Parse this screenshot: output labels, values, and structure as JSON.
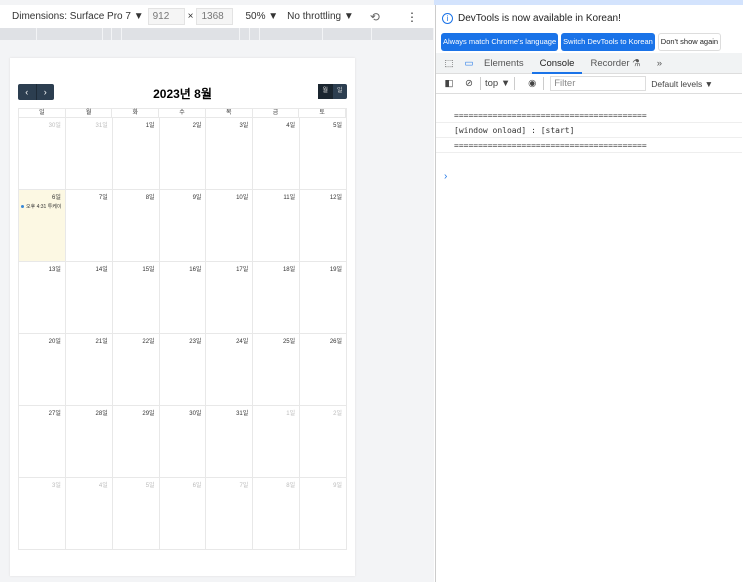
{
  "device_toolbar": {
    "dimensions": "Dimensions: Surface Pro 7 ▼",
    "width": "912",
    "x": "×",
    "height": "1368",
    "zoom": "50% ▼",
    "throttling": "No throttling ▼",
    "rotate_icon": "⟲",
    "more_icon": "⋮"
  },
  "calendar": {
    "prev": "‹",
    "next": "›",
    "title": "2023년 8월",
    "view_month": "월",
    "view_day": "일",
    "weekdays": [
      "일",
      "월",
      "화",
      "수",
      "목",
      "금",
      "토"
    ],
    "weeks": [
      [
        {
          "d": "30일",
          "o": true
        },
        {
          "d": "31일",
          "o": true
        },
        {
          "d": "1일"
        },
        {
          "d": "2일"
        },
        {
          "d": "3일"
        },
        {
          "d": "4일"
        },
        {
          "d": "5일"
        }
      ],
      [
        {
          "d": "6일",
          "today": true,
          "ev": "오후 4:31 투케이"
        },
        {
          "d": "7일"
        },
        {
          "d": "8일"
        },
        {
          "d": "9일"
        },
        {
          "d": "10일"
        },
        {
          "d": "11일"
        },
        {
          "d": "12일"
        }
      ],
      [
        {
          "d": "13일"
        },
        {
          "d": "14일"
        },
        {
          "d": "15일"
        },
        {
          "d": "16일"
        },
        {
          "d": "17일"
        },
        {
          "d": "18일"
        },
        {
          "d": "19일"
        }
      ],
      [
        {
          "d": "20일"
        },
        {
          "d": "21일"
        },
        {
          "d": "22일"
        },
        {
          "d": "23일"
        },
        {
          "d": "24일"
        },
        {
          "d": "25일"
        },
        {
          "d": "26일"
        }
      ],
      [
        {
          "d": "27일"
        },
        {
          "d": "28일"
        },
        {
          "d": "29일"
        },
        {
          "d": "30일"
        },
        {
          "d": "31일"
        },
        {
          "d": "1일",
          "o": true
        },
        {
          "d": "2일",
          "o": true
        }
      ],
      [
        {
          "d": "3일",
          "o": true
        },
        {
          "d": "4일",
          "o": true
        },
        {
          "d": "5일",
          "o": true
        },
        {
          "d": "6일",
          "o": true
        },
        {
          "d": "7일",
          "o": true
        },
        {
          "d": "8일",
          "o": true
        },
        {
          "d": "9일",
          "o": true
        }
      ]
    ]
  },
  "devtools": {
    "info": "DevTools is now available in Korean!",
    "btn_match": "Always match Chrome's language",
    "btn_switch": "Switch DevTools to Korean",
    "btn_dont": "Don't show again",
    "tabs": {
      "elements": "Elements",
      "console": "Console",
      "recorder": "Recorder ⚗",
      "more": "»"
    },
    "toolbar": {
      "context": "top ▼",
      "filter_placeholder": "Filter",
      "levels": "Default levels ▼"
    },
    "console_lines": [
      "========================================",
      "[window onload] : [start]",
      "========================================"
    ],
    "prompt": "›"
  }
}
